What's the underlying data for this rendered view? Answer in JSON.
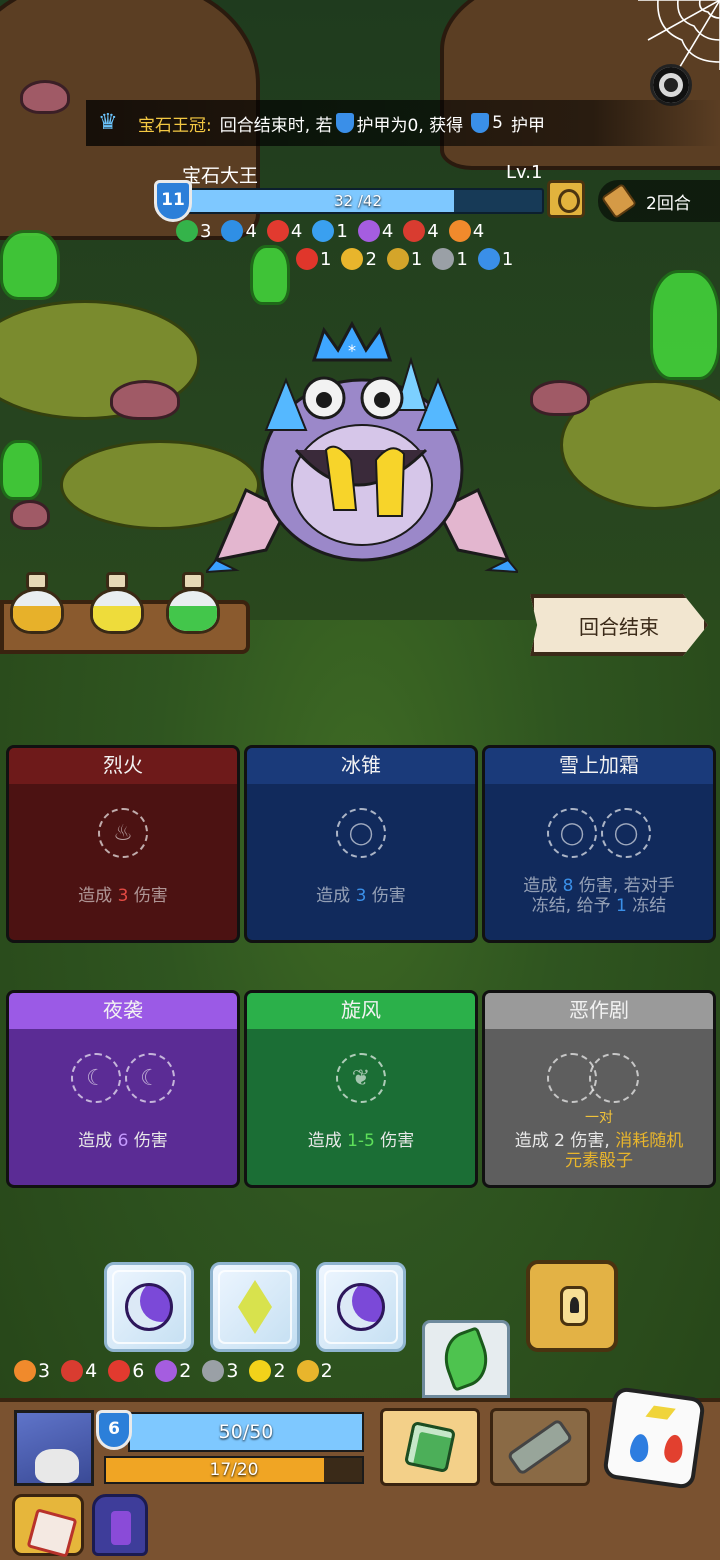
{
  "relic": {
    "icon": "crown-icon",
    "name": "宝石王冠:",
    "text_1": "回合结束时, 若",
    "text_2": "护甲为0, 获得",
    "value": "5",
    "text_3": "护甲"
  },
  "enemy": {
    "name": "宝石大王",
    "level": "Lv.1",
    "shield": "11",
    "hp_text": "32 /42",
    "hp_current": 32,
    "hp_max": 42,
    "statuses_row1": [
      {
        "icon": "green-swirl-icon",
        "color": "#34b34a",
        "value": "3"
      },
      {
        "icon": "blue-skull-icon",
        "color": "#2f8fe5",
        "value": "4"
      },
      {
        "icon": "red-demon-icon",
        "color": "#e23a2f",
        "value": "4"
      },
      {
        "icon": "snowflake-icon",
        "color": "#3aa0f0",
        "value": "1"
      },
      {
        "icon": "purple-splat-icon",
        "color": "#a55de0",
        "value": "4"
      },
      {
        "icon": "red-claw-icon",
        "color": "#d93c30",
        "value": "4"
      },
      {
        "icon": "orange-flame-icon",
        "color": "#f08a2c",
        "value": "4"
      }
    ],
    "statuses_row2": [
      {
        "icon": "fire-icon",
        "color": "#e0362b",
        "value": "1"
      },
      {
        "icon": "yellow-paw-icon",
        "color": "#e8b52c",
        "value": "2"
      },
      {
        "icon": "lock-icon",
        "color": "#d4a52a",
        "value": "1"
      },
      {
        "icon": "grey-cloud-icon",
        "color": "#9aa0a6",
        "value": "1"
      },
      {
        "icon": "blue-vortex-icon",
        "color": "#3a8fe8",
        "value": "1"
      }
    ]
  },
  "turn_counter": "2回合",
  "end_turn_label": "回合结束",
  "potions": [
    {
      "color": "#e7b12a"
    },
    {
      "color": "#eedc3b"
    },
    {
      "color": "#43c64b"
    }
  ],
  "cards": [
    {
      "title": "烈火",
      "head_color": "#6e1a1a",
      "body_color": "#4c1212",
      "slots": [
        "fire-slot-icon"
      ],
      "desc_pre": "造成",
      "desc_num": "3",
      "desc_num_class": "num-r",
      "desc_post": "伤害",
      "dim": true
    },
    {
      "title": "冰锥",
      "head_color": "#1a3a7a",
      "body_color": "#112a5c",
      "slots": [
        "water-slot-icon"
      ],
      "desc_pre": "造成",
      "desc_num": "3",
      "desc_num_class": "num-b",
      "desc_post": "伤害",
      "dim": true
    },
    {
      "title": "雪上加霜",
      "head_color": "#1a3a7a",
      "body_color": "#112a5c",
      "slots": [
        "water-slot-icon",
        "water-slot-icon"
      ],
      "desc_pre": "造成",
      "desc_num": "8",
      "desc_num_class": "num-b",
      "desc_post": "伤害, 若对手",
      "desc_line2_pre": "冻结, 给予",
      "desc_line2_num": "1",
      "desc_line2_post": "冻结",
      "dim": true
    },
    {
      "title": "夜袭",
      "head_color": "#9b5ae6",
      "body_color": "#5b2c95",
      "slots": [
        "moon-slot-icon",
        "moon-slot-icon"
      ],
      "desc_pre": "造成",
      "desc_num": "6",
      "desc_num_class": "num-p",
      "desc_post": "伤害",
      "dim": false
    },
    {
      "title": "旋风",
      "head_color": "#2bb04a",
      "body_color": "#1b6e35",
      "slots": [
        "leaf-slot-icon"
      ],
      "desc_pre": "造成",
      "desc_num": "1-5",
      "desc_num_class": "num-g",
      "desc_post": "伤害",
      "dim": false
    },
    {
      "title": "恶作剧",
      "head_color": "#9a9a9a",
      "body_color": "#5e5e5e",
      "slots": [
        "pair-slot-icon",
        "pair-slot-icon"
      ],
      "pair_label": "一对",
      "desc_pre": "造成",
      "desc_num": "2",
      "desc_num_class": "",
      "desc_post": "伤害,",
      "desc_tail": "消耗随机",
      "desc_line2_tail": "元素骰子",
      "dim": false
    }
  ],
  "dice_tray": [
    {
      "face": "moon"
    },
    {
      "face": "diamond"
    },
    {
      "face": "moon"
    }
  ],
  "player_elements": [
    {
      "icon": "orange-flame-icon",
      "color": "#f08a2c",
      "value": "3"
    },
    {
      "icon": "red-claw-icon",
      "color": "#d93c30",
      "value": "4"
    },
    {
      "icon": "red-demon-icon",
      "color": "#e23a2f",
      "value": "6"
    },
    {
      "icon": "purple-splat-icon",
      "color": "#a55de0",
      "value": "2"
    },
    {
      "icon": "grey-skull-icon",
      "color": "#9aa0a6",
      "value": "3"
    },
    {
      "icon": "lightning-icon",
      "color": "#f2d21a",
      "value": "2"
    },
    {
      "icon": "yellow-paw-icon",
      "color": "#e8b52c",
      "value": "2"
    }
  ],
  "player": {
    "shield": "6",
    "hp_text": "50/50",
    "hp_current": 50,
    "hp_max": 50,
    "xp_text": "17/20",
    "xp_current": 17,
    "xp_max": 20
  }
}
